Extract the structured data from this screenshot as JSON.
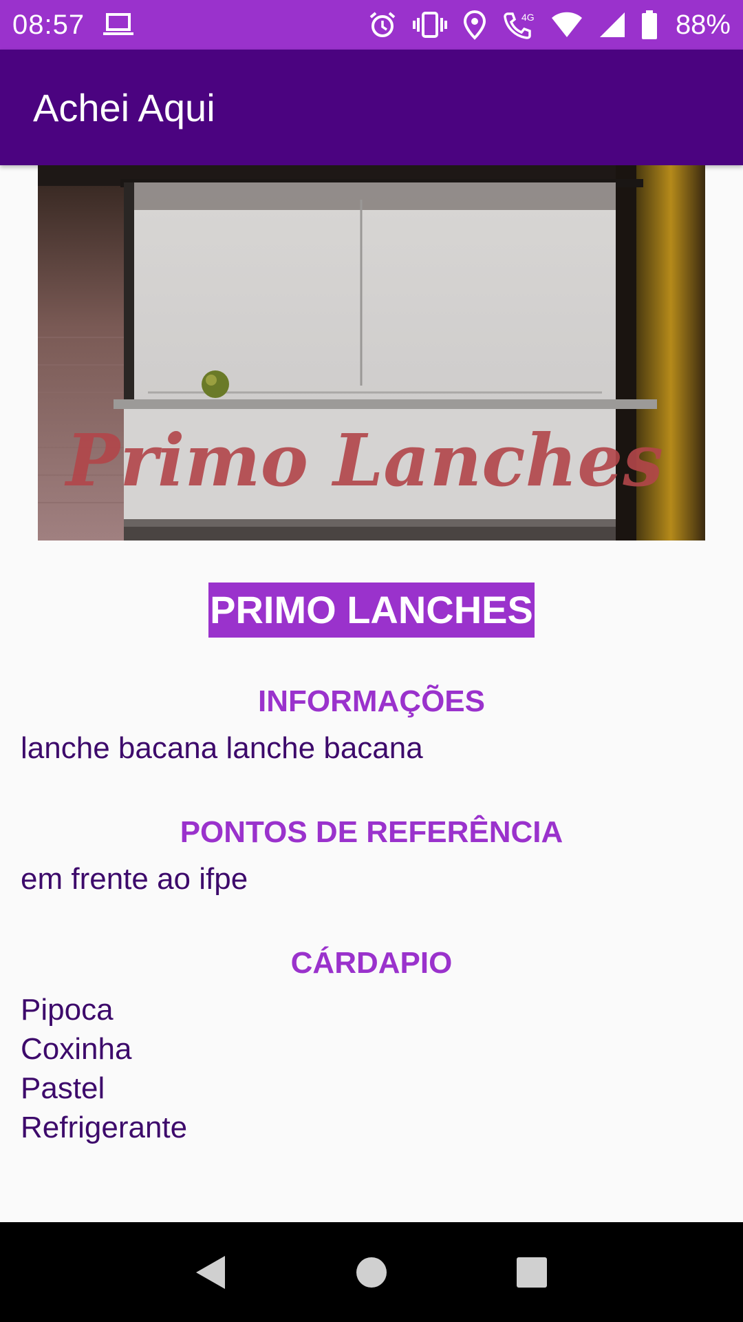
{
  "status_bar": {
    "time": "08:57",
    "battery": "88%",
    "color": "#9a32cc",
    "icons": [
      "laptop-icon",
      "alarm-icon",
      "vibrate-icon",
      "location-icon",
      "wifi-calling-icon",
      "wifi-icon",
      "signal-icon",
      "battery-icon"
    ],
    "network_label": "4G"
  },
  "app_bar": {
    "title": "Achei Aqui",
    "color": "#4b0380"
  },
  "place": {
    "photo_sign_text": "Primo Lanches",
    "name": "PRIMO LANCHES"
  },
  "sections": {
    "info_title": "INFORMAÇÕES",
    "info_text": "lanche bacana lanche bacana",
    "reference_title": "PONTOS DE REFERÊNCIA",
    "reference_text": "em frente ao ifpe",
    "menu_title": "CÁRDAPIO",
    "menu_items": [
      "Pipoca",
      "Coxinha",
      "Pastel",
      "Refrigerante"
    ]
  },
  "nav_bar": {
    "icons": [
      "back-icon",
      "home-icon",
      "recents-icon"
    ]
  }
}
